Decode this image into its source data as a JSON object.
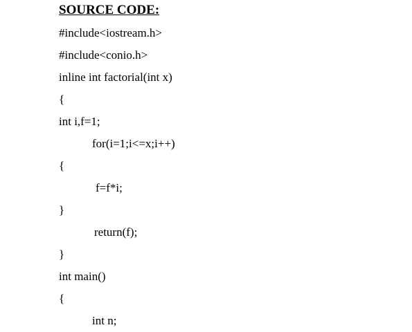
{
  "heading": "SOURCE CODE:",
  "code_lines": [
    "#include<iostream.h>",
    "#include<conio.h>",
    "inline int factorial(int x)",
    "{",
    "int i,f=1;",
    "for(i=1;i<=x;i++)",
    "{",
    "f=f*i;",
    "}",
    "return(f);",
    "}",
    "int main()",
    "{",
    "int n;"
  ]
}
